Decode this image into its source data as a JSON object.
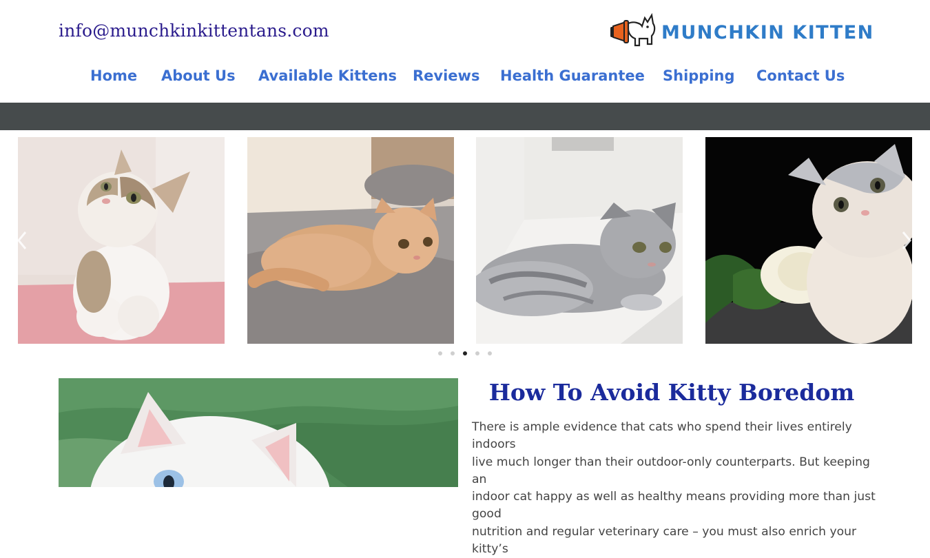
{
  "header": {
    "email": "info@munchkinkittentans.com",
    "logo_text": "MUNCHKIN KITTEN"
  },
  "nav": {
    "items": [
      {
        "label": "Home"
      },
      {
        "label": "About Us"
      },
      {
        "label": "Available Kittens"
      },
      {
        "label": "Reviews"
      },
      {
        "label": "Health Guarantee"
      },
      {
        "label": "Shipping"
      },
      {
        "label": "Contact Us"
      }
    ]
  },
  "slider": {
    "prev_icon": "chevron-left-icon",
    "next_icon": "chevron-right-icon",
    "slides": [
      {
        "subject": "tabby-white kitten on pink stool"
      },
      {
        "subject": "orange kitten on gray rug"
      },
      {
        "subject": "gray tabby kitten lying on floor"
      },
      {
        "subject": "gray-white kitten with white rose"
      }
    ],
    "dot_count": 5,
    "active_dot": 3
  },
  "article": {
    "title": "How To Avoid Kitty Boredom",
    "lines": [
      "There is ample evidence that cats who spend their lives entirely indoors",
      "live much longer than their outdoor-only counterparts. But keeping an",
      "indoor cat happy as well as healthy means providing more than just good",
      "nutrition and regular veterinary care – you must also enrich your kitty’s"
    ]
  },
  "colors": {
    "email": "#2a1b8c",
    "nav": "#3b6fd1",
    "logo": "#2f7cc8",
    "logo_accent": "#e8621e",
    "bar": "#464b4c",
    "title": "#1b2b9c",
    "body_text": "#444444"
  }
}
